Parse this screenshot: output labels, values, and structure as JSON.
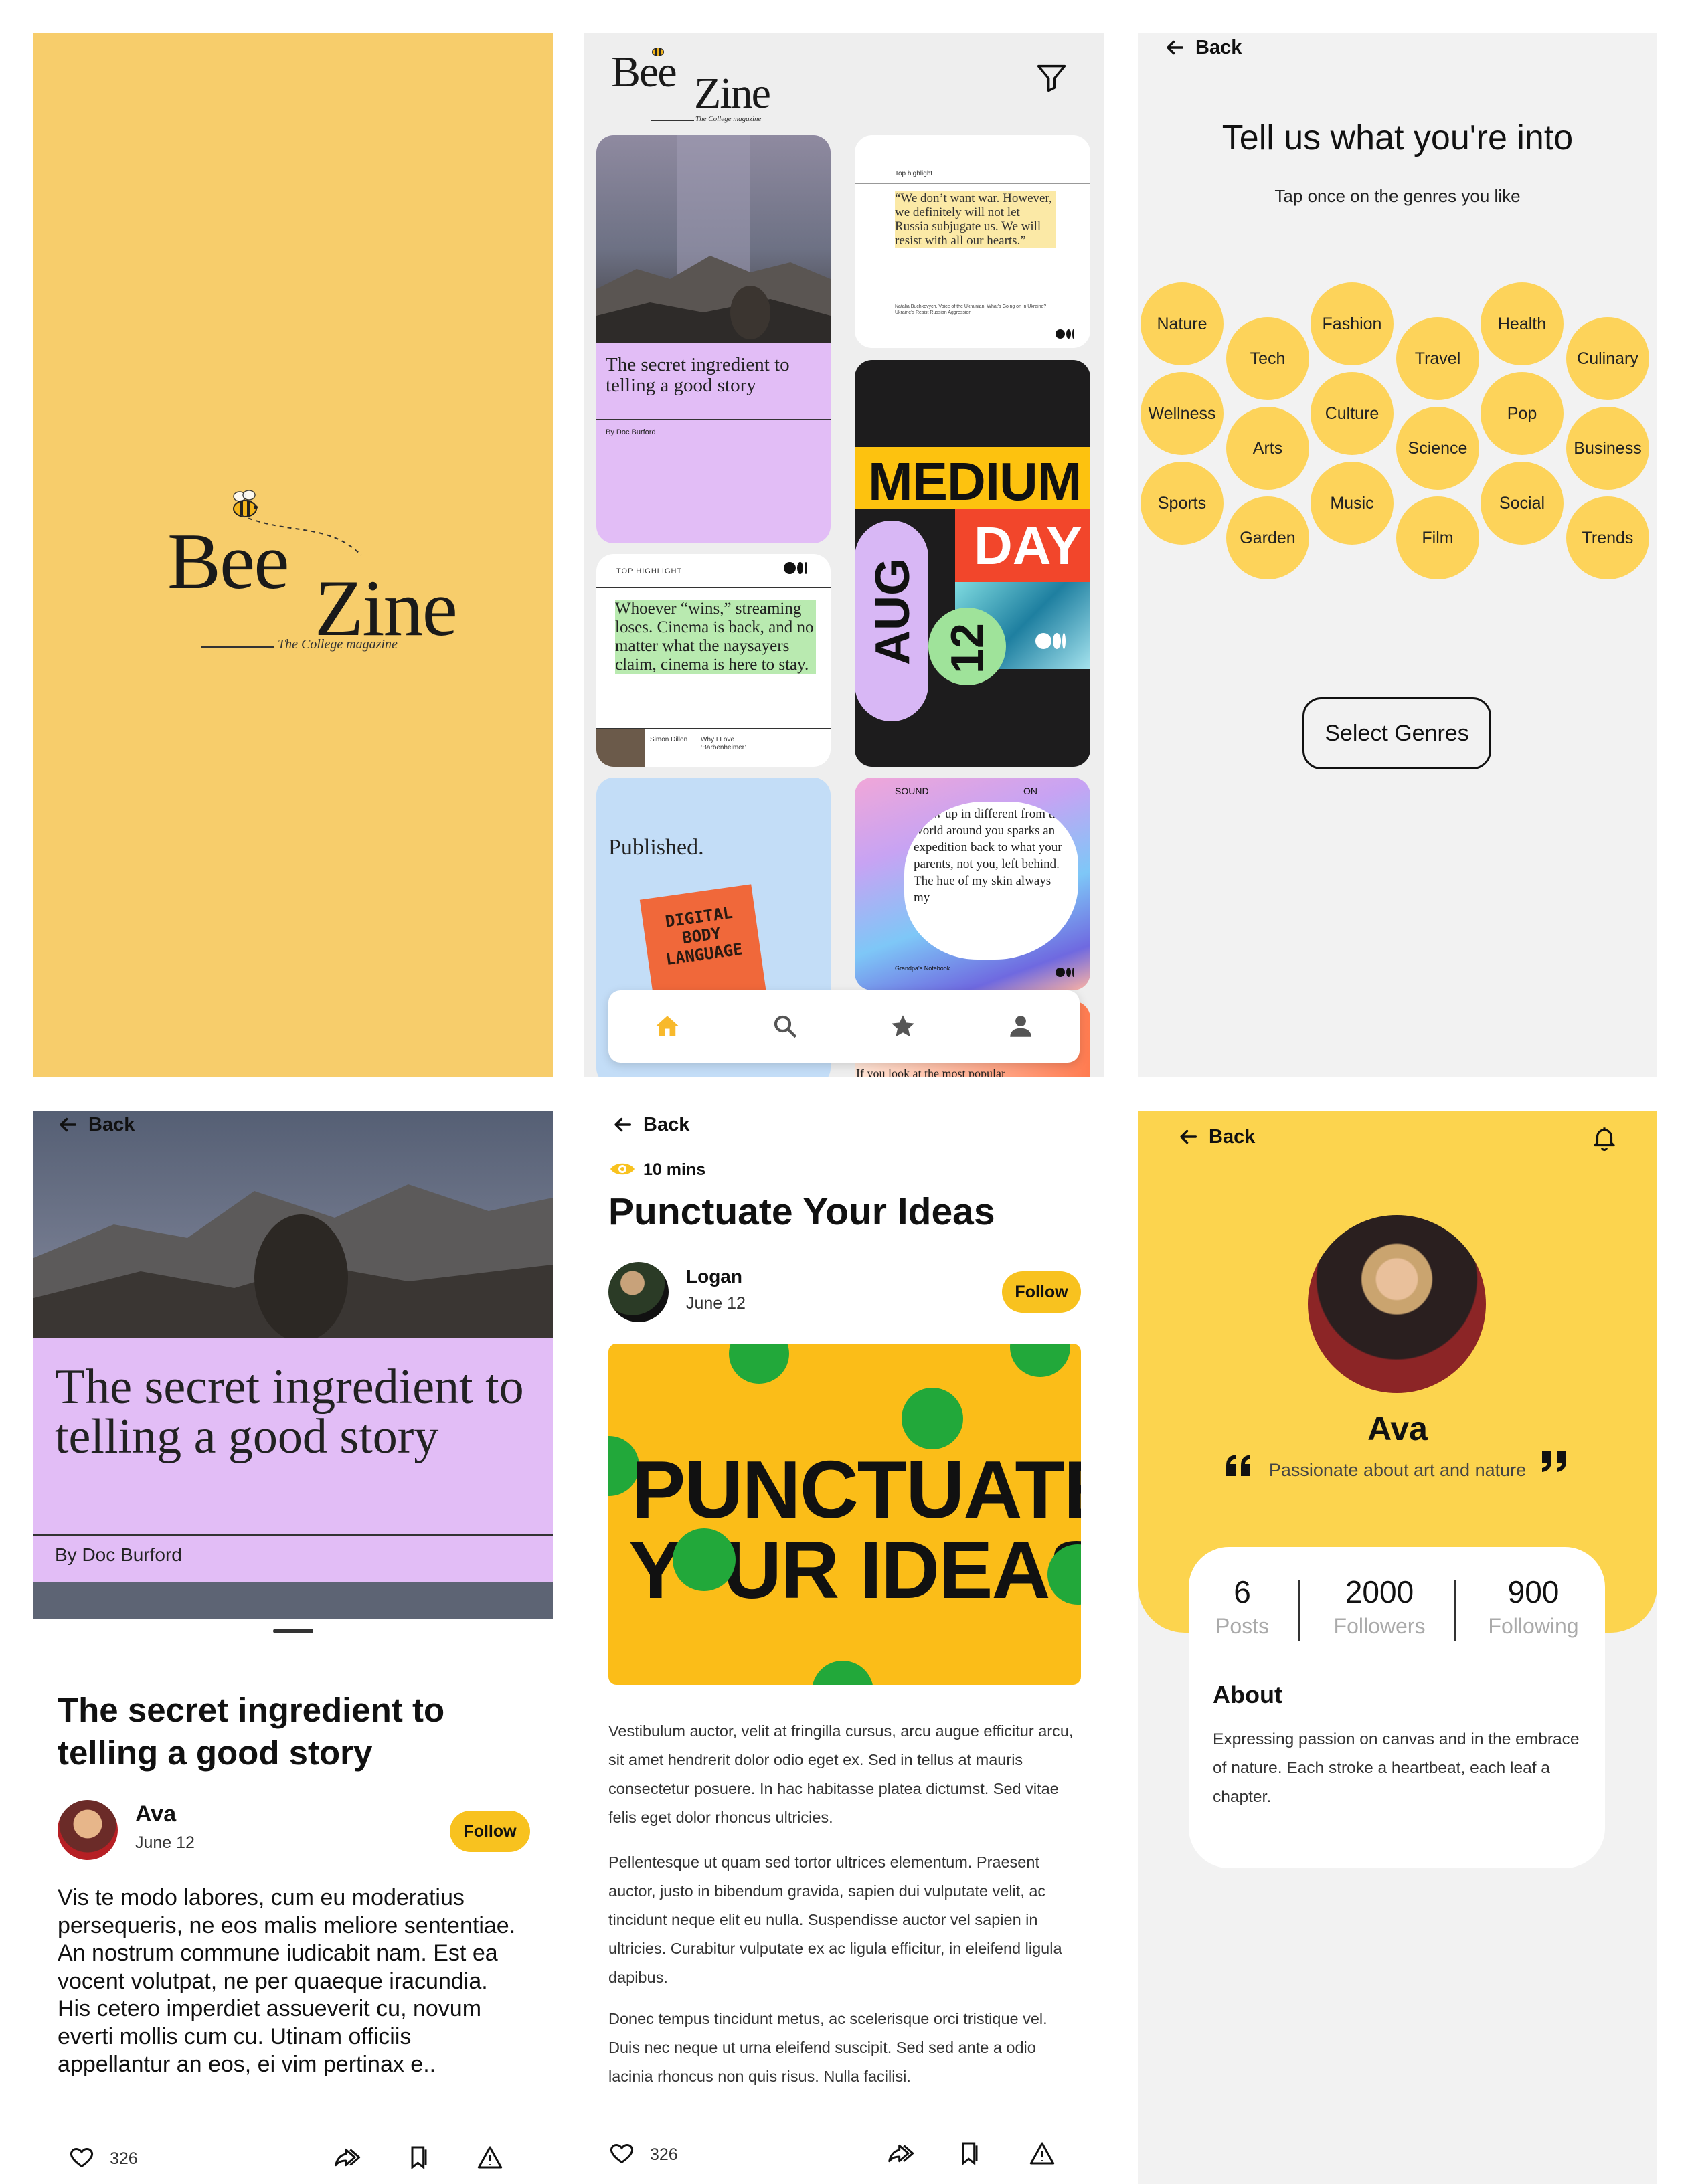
{
  "splash": {
    "logo_word1": "Bee",
    "logo_word2": "Zine",
    "tagline": "The College magazine"
  },
  "feed": {
    "logo_word1": "Bee",
    "logo_word2": "Zine",
    "tagline": "The College magazine",
    "card1": {
      "title": "The secret ingredient to telling a good story",
      "byline": "By Doc Burford"
    },
    "card2": {
      "label": "Top highlight",
      "quote": "“We don’t want war. However, we definitely will not let Russia subjugate us. We will resist with all our hearts.”",
      "footer": "Natalia Buchkovych, Voice of the Ukrainian: What’s Going on in Ukraine? Ukraine’s Resist Russian Aggression"
    },
    "card3": {
      "label": "TOP HIGHLIGHT",
      "quote": "Whoever “wins,” streaming loses. Cinema is back, and no matter what the naysayers claim, cinema is here to stay.",
      "author": "Simon Dillon",
      "article": "Why I Love ‘Barbenheimer’"
    },
    "card4": {
      "word1": "MEDIUM",
      "word2": "DAY",
      "month": "AUG",
      "day": "12"
    },
    "card5": {
      "text": "Published.",
      "book": "DIGITAL BODY LANGUAGE"
    },
    "card6": {
      "label": "SOUND",
      "label2": "ON",
      "poem": "…ow up in different from the world around you sparks an expedition back to what your parents, not you, left behind. The hue of my skin always my",
      "footer": "Grandpa's Notebook"
    },
    "card7": {
      "text": "If you look at the most popular"
    }
  },
  "genres": {
    "back": "Back",
    "title": "Tell us what you're into",
    "subtitle": "Tap once on the genres you like",
    "items": [
      "Nature",
      "Fashion",
      "Health",
      "Tech",
      "Travel",
      "Culinary",
      "Wellness",
      "Culture",
      "Pop",
      "Arts",
      "Science",
      "Business",
      "Sports",
      "Music",
      "Social",
      "Garden",
      "Film",
      "Trends"
    ],
    "button": "Select Genres"
  },
  "article1": {
    "back": "Back",
    "hero_title": "The secret ingredient to telling a good story",
    "byline": "By Doc Burford",
    "title": "The secret ingredient to telling a good story",
    "author": "Ava",
    "date": "June 12",
    "follow": "Follow",
    "body": "Vis te modo labores, cum eu moderatius persequeris, ne eos malis meliore sententiae. An nostrum commune iudicabit nam. Est ea vocent volutpat, ne per quaeque iracundia. His cetero imperdiet assueverit cu, novum everti mollis cum cu. Utinam officiis appellantur an eos, ei vim pertinax e..",
    "likes": "326"
  },
  "article2": {
    "back": "Back",
    "read_time": "10 mins",
    "title": "Punctuate Your Ideas",
    "author": "Logan",
    "date": "June 12",
    "follow": "Follow",
    "image_line1": "PUNCTUATE",
    "image_line2": "Y  UR IDEAS",
    "p1": "Vestibulum auctor, velit at fringilla cursus, arcu augue efficitur arcu, sit amet hendrerit dolor odio eget ex. Sed in tellus at mauris consectetur posuere. In hac habitasse platea dictumst. Sed vitae felis eget dolor rhoncus ultricies.",
    "p2": "Pellentesque ut quam sed tortor ultrices elementum. Praesent auctor, justo in bibendum gravida, sapien dui vulputate velit, ac tincidunt neque elit eu nulla. Suspendisse auctor vel sapien in ultricies. Curabitur vulputate ex ac ligula efficitur, in eleifend ligula dapibus.",
    "p3": "Donec tempus tincidunt metus, ac scelerisque orci tristique vel. Duis nec neque ut urna eleifend suscipit. Sed sed ante a odio lacinia rhoncus non quis risus. Nulla facilisi.",
    "likes": "326"
  },
  "profile": {
    "back": "Back",
    "name": "Ava",
    "bio": "Passionate about art and nature",
    "stats": [
      {
        "value": "6",
        "label": "Posts"
      },
      {
        "value": "2000",
        "label": "Followers"
      },
      {
        "value": "900",
        "label": "Following"
      }
    ],
    "about_title": "About",
    "about_text": "Expressing passion on canvas and in the embrace of nature. Each stroke a heartbeat, each leaf a chapter."
  },
  "colors": {
    "accent_yellow": "#f8c21f",
    "splash_bg": "#f7cd6b",
    "lavender": "#e2bdf6",
    "genre_yellow": "#fdd35a",
    "green_dot": "#22a83a"
  },
  "icons": [
    "arrow-left-icon",
    "filter-icon",
    "home-icon",
    "search-icon",
    "star-icon",
    "user-icon",
    "heart-icon",
    "share-icon",
    "bookmark-icon",
    "warning-icon",
    "eye-icon",
    "bell-icon",
    "quote-icon",
    "bee-icon"
  ]
}
